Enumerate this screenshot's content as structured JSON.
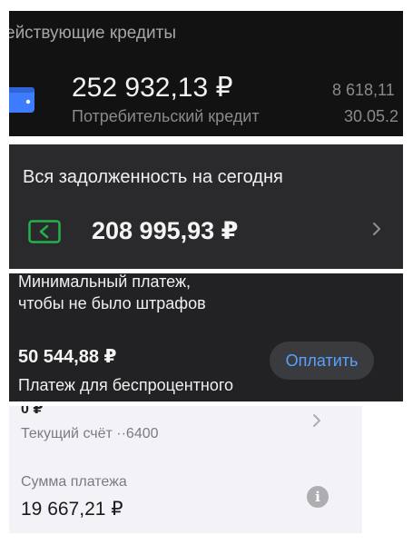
{
  "active_credits": {
    "heading": "ействующие кредиты",
    "amount": "252 932,13 ₽",
    "product": "Потребительский кредит",
    "right_amount": "8 618,11",
    "right_date": "30.05.2",
    "icon": "wallet-card-icon",
    "accent_color": "#3d7cff"
  },
  "total_debt": {
    "title": "Вся задолженность на сегодня",
    "amount": "208 995,93 ₽",
    "icon": "money-bill-icon",
    "icon_color": "#22b14c"
  },
  "min_payment": {
    "title_line1": "Минимальный платеж,",
    "title_line2": "чтобы не было штрафов",
    "amount": "50 544,88 ₽",
    "pay_button": "Оплатить",
    "subtitle": "Платеж для беспроцентного",
    "button_text_color": "#5aa0ff"
  },
  "account": {
    "cut_text": "0 ₽",
    "account_label": "Текущий счёт ··6400",
    "sum_label": "Сумма платежа",
    "sum_main": "19 667,",
    "sum_kop": "21 ₽",
    "info_icon": "info-icon"
  }
}
